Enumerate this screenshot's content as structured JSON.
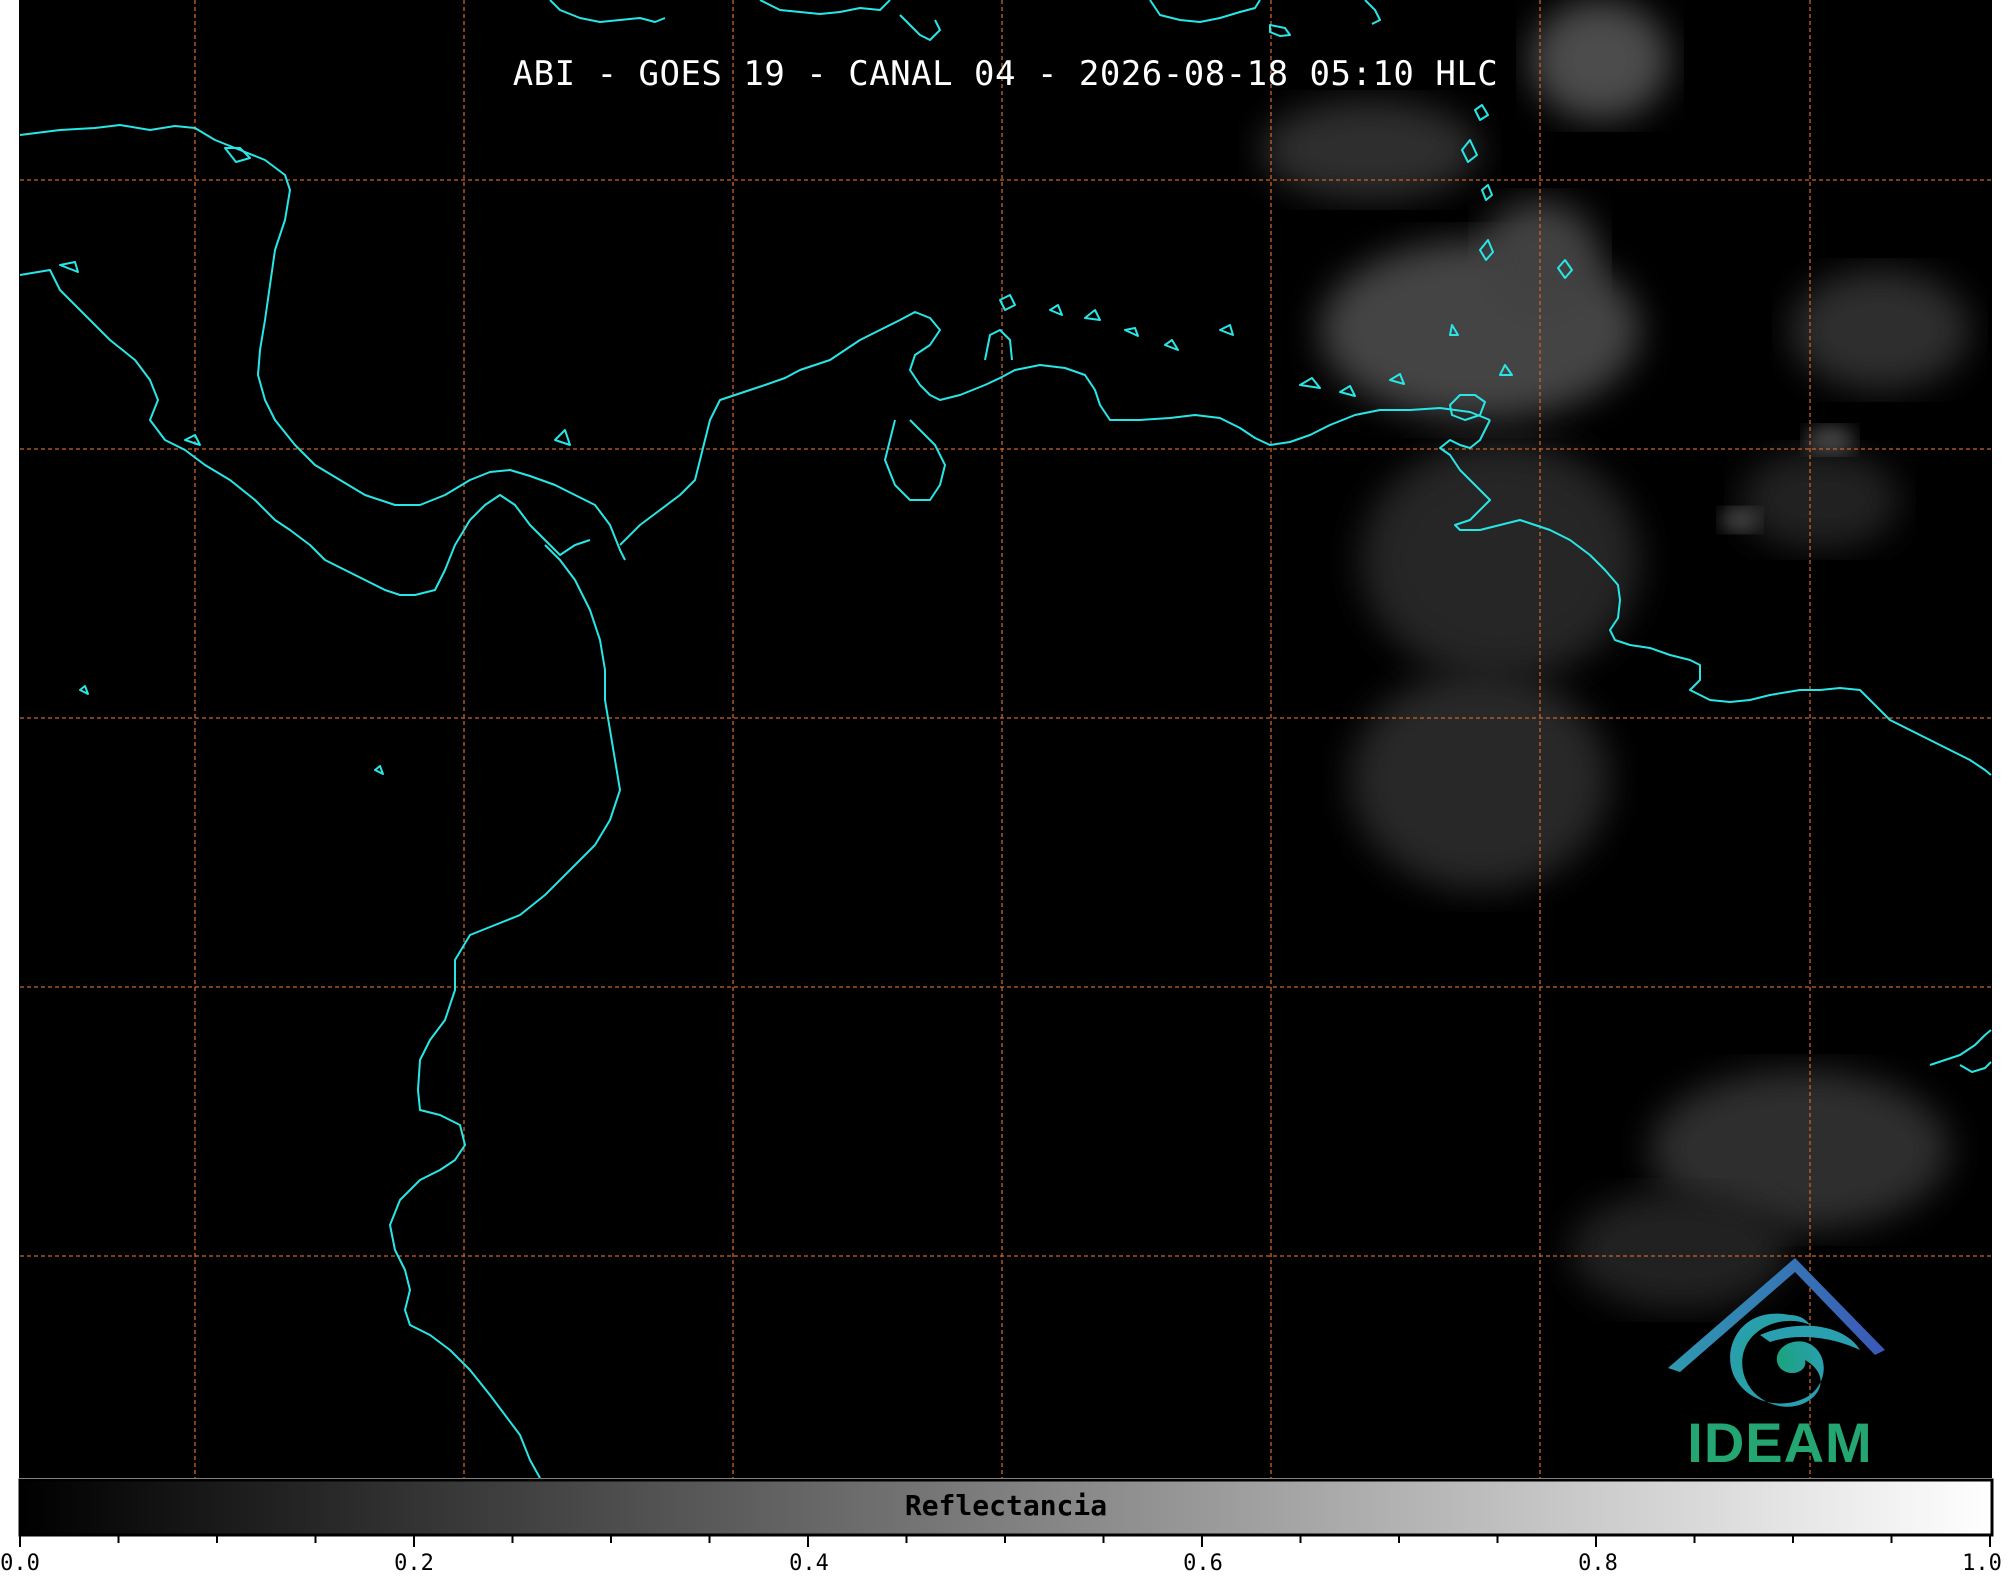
{
  "title": "ABI - GOES 19 - CANAL 04 - 2026-08-18 05:10 HLC",
  "logo": {
    "name": "ideam-logo",
    "text": "IDEAM"
  },
  "colorbar": {
    "label": "Reflectancia",
    "min": 0.0,
    "max": 1.0,
    "tick_labels": [
      "0.0",
      "0.2",
      "0.4",
      "0.6",
      "0.8",
      "1.0"
    ],
    "minor_tick_step": 0.05,
    "colormap": "grayscale"
  },
  "map": {
    "background_color": "#000000",
    "coastline_color": "#29e6e6",
    "gridline_color": "#c8642a",
    "gridline_style": "dashed",
    "clouds_color": "#7a7a7a"
  }
}
